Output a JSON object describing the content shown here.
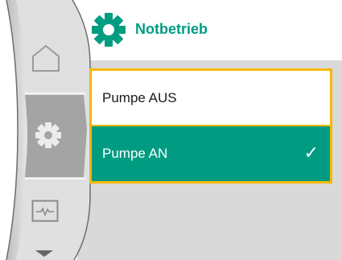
{
  "header": {
    "title": "Notbetrieb",
    "icon": "gear-icon"
  },
  "sidebar": {
    "items": [
      {
        "name": "home",
        "icon": "home-icon",
        "active": false
      },
      {
        "name": "settings",
        "icon": "gear-icon",
        "active": true
      },
      {
        "name": "monitor",
        "icon": "monitor-icon",
        "active": false
      },
      {
        "name": "scroll-down",
        "icon": "chevron-down-icon",
        "active": false
      }
    ]
  },
  "options": [
    {
      "label": "Pumpe AUS",
      "selected": false
    },
    {
      "label": "Pumpe AN",
      "selected": true,
      "mark": "✓"
    }
  ],
  "colors": {
    "accent": "#009c82",
    "focus": "#f5b800",
    "background": "#d9d9d9",
    "sidebar_active": "#a4a4a4"
  }
}
